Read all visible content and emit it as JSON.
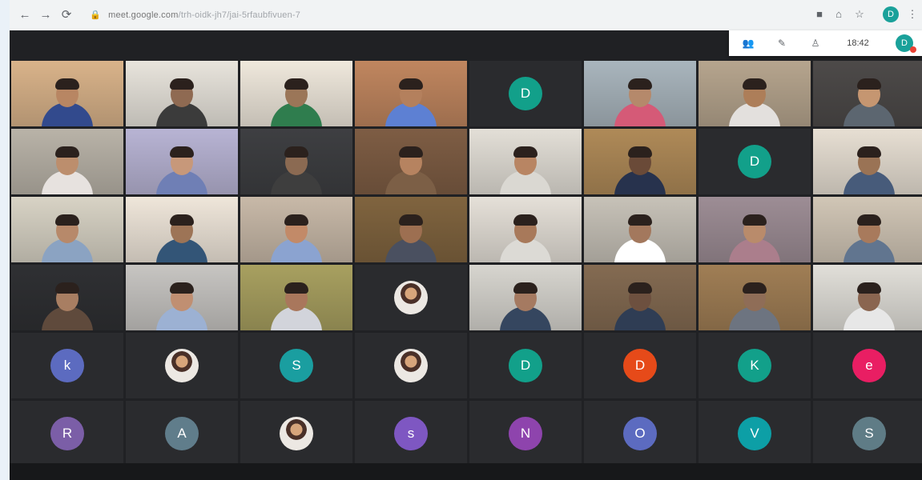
{
  "browser": {
    "url": "meet.google.com",
    "url_tail": "/trh-oidk-jh7/jai-5rfaubfivuen-7",
    "profile_initial": "D"
  },
  "meet": {
    "time": "18:42",
    "self_initial": "D"
  },
  "grid": {
    "video_rows": 4,
    "avatar_rows": 2,
    "columns": 8
  },
  "avatars": [
    {
      "letter": "D",
      "color": "#12a08a",
      "col": 4,
      "row": 0
    },
    {
      "letter": "D",
      "color": "#12a08a",
      "col": 6,
      "row": 1
    },
    {
      "letter": "k",
      "color": "#5c6bc0",
      "col": 0,
      "row": 4
    },
    {
      "letter": "S",
      "color": "#1a9ea0",
      "col": 2,
      "row": 4
    },
    {
      "letter": "D",
      "color": "#12a08a",
      "col": 4,
      "row": 4
    },
    {
      "letter": "D",
      "color": "#e64a19",
      "col": 5,
      "row": 4
    },
    {
      "letter": "K",
      "color": "#12a08a",
      "col": 6,
      "row": 4
    },
    {
      "letter": "e",
      "color": "#e91e63",
      "col": 7,
      "row": 4
    },
    {
      "letter": "R",
      "color": "#7b5ea7",
      "col": 0,
      "row": 5
    },
    {
      "letter": "A",
      "color": "#607d8b",
      "col": 1,
      "row": 5
    },
    {
      "letter": "s",
      "color": "#7e57c2",
      "col": 3,
      "row": 5
    },
    {
      "letter": "N",
      "color": "#8e44ad",
      "col": 4,
      "row": 5
    },
    {
      "letter": "O",
      "color": "#5c6bc0",
      "col": 5,
      "row": 5
    },
    {
      "letter": "V",
      "color": "#0d9fa6",
      "col": 6,
      "row": 5
    },
    {
      "letter": "S",
      "color": "#5f7c86",
      "col": 7,
      "row": 5
    }
  ],
  "photo_avatars": [
    {
      "col": 3,
      "row": 3
    },
    {
      "col": 1,
      "row": 4
    },
    {
      "col": 3,
      "row": 4
    },
    {
      "col": 2,
      "row": 5
    }
  ],
  "video_tiles": [
    {
      "col": 0,
      "row": 0,
      "bg": "#d9b38a",
      "shirt": "#324a8d",
      "skin": "#b88663"
    },
    {
      "col": 1,
      "row": 0,
      "bg": "#e8e4dc",
      "shirt": "#3b3b3b",
      "skin": "#8f6a52"
    },
    {
      "col": 2,
      "row": 0,
      "bg": "#efe8dc",
      "shirt": "#2f7d4e",
      "skin": "#9b7658"
    },
    {
      "col": 3,
      "row": 0,
      "bg": "#c0865f",
      "shirt": "#5d80d3",
      "skin": "#b4805d"
    },
    {
      "col": 5,
      "row": 0,
      "bg": "#a9b5bd",
      "shirt": "#d55a77",
      "skin": "#b5896b"
    },
    {
      "col": 6,
      "row": 0,
      "bg": "#b6a58e",
      "shirt": "#e3e0dd",
      "skin": "#ad7e59"
    },
    {
      "col": 7,
      "row": 0,
      "bg": "#4d4a49",
      "shirt": "#5c6670",
      "skin": "#c59671"
    },
    {
      "col": 0,
      "row": 1,
      "bg": "#b9b3a8",
      "shirt": "#e7e2df",
      "skin": "#bc8e6d"
    },
    {
      "col": 1,
      "row": 1,
      "bg": "#b8b4d4",
      "shirt": "#6f7fb5",
      "skin": "#c7987a"
    },
    {
      "col": 2,
      "row": 1,
      "bg": "#3e3f42",
      "shirt": "#3e3e3e",
      "skin": "#8b6a52"
    },
    {
      "col": 3,
      "row": 1,
      "bg": "#7e5d44",
      "shirt": "#7c5f46",
      "skin": "#b68360"
    },
    {
      "col": 4,
      "row": 1,
      "bg": "#e3dfd7",
      "shirt": "#dad8d2",
      "skin": "#b88563"
    },
    {
      "col": 5,
      "row": 1,
      "bg": "#af8a58",
      "shirt": "#27324d",
      "skin": "#6a4a38"
    },
    {
      "col": 7,
      "row": 1,
      "bg": "#e7dfd3",
      "shirt": "#475b7a",
      "skin": "#9a7355"
    },
    {
      "col": 0,
      "row": 2,
      "bg": "#d8d3c5",
      "shirt": "#8ba3c2",
      "skin": "#b7896a"
    },
    {
      "col": 1,
      "row": 2,
      "bg": "#efe6da",
      "shirt": "#335577",
      "skin": "#9d7456"
    },
    {
      "col": 2,
      "row": 2,
      "bg": "#c8b9a8",
      "shirt": "#8ba3d0",
      "skin": "#c28a68"
    },
    {
      "col": 3,
      "row": 2,
      "bg": "#80643f",
      "shirt": "#4a5060",
      "skin": "#9d6f51"
    },
    {
      "col": 4,
      "row": 2,
      "bg": "#e5e0d8",
      "shirt": "#dcdad5",
      "skin": "#a8795a"
    },
    {
      "col": 5,
      "row": 2,
      "bg": "#c7c2b8",
      "shirt": "#ffffff",
      "skin": "#a3785d"
    },
    {
      "col": 6,
      "row": 2,
      "bg": "#9d8d95",
      "shirt": "#ab7e8c",
      "skin": "#b98b6b"
    },
    {
      "col": 7,
      "row": 2,
      "bg": "#d1c6b6",
      "shirt": "#61758f",
      "skin": "#a87a5c"
    },
    {
      "col": 0,
      "row": 3,
      "bg": "#2f3033",
      "shirt": "#5f4a3c",
      "skin": "#a87e62"
    },
    {
      "col": 1,
      "row": 3,
      "bg": "#c7c5c2",
      "shirt": "#9cb1d3",
      "skin": "#c08f72"
    },
    {
      "col": 2,
      "row": 3,
      "bg": "#a8a060",
      "shirt": "#d2d4db",
      "skin": "#a9775c"
    },
    {
      "col": 4,
      "row": 3,
      "bg": "#d7d5cf",
      "shirt": "#35465f",
      "skin": "#a57a61"
    },
    {
      "col": 5,
      "row": 3,
      "bg": "#846b52",
      "shirt": "#2f3d54",
      "skin": "#6d503f"
    },
    {
      "col": 6,
      "row": 3,
      "bg": "#a07e55",
      "shirt": "#6d7480",
      "skin": "#8f6d57"
    },
    {
      "col": 7,
      "row": 3,
      "bg": "#e1dfd9",
      "shirt": "#e7e7e7",
      "skin": "#8a6550"
    }
  ],
  "empty_tiles": [
    {
      "col": 0,
      "row": 4
    },
    {
      "col": 1,
      "row": 4
    },
    {
      "col": 2,
      "row": 4
    },
    {
      "col": 3,
      "row": 4
    },
    {
      "col": 4,
      "row": 4
    },
    {
      "col": 5,
      "row": 4
    },
    {
      "col": 6,
      "row": 4
    },
    {
      "col": 7,
      "row": 4
    },
    {
      "col": 0,
      "row": 5
    },
    {
      "col": 1,
      "row": 5
    },
    {
      "col": 2,
      "row": 5
    },
    {
      "col": 3,
      "row": 5
    },
    {
      "col": 4,
      "row": 5
    },
    {
      "col": 5,
      "row": 5
    },
    {
      "col": 6,
      "row": 5
    },
    {
      "col": 7,
      "row": 5
    },
    {
      "col": 4,
      "row": 0
    },
    {
      "col": 6,
      "row": 1
    },
    {
      "col": 3,
      "row": 3
    }
  ]
}
